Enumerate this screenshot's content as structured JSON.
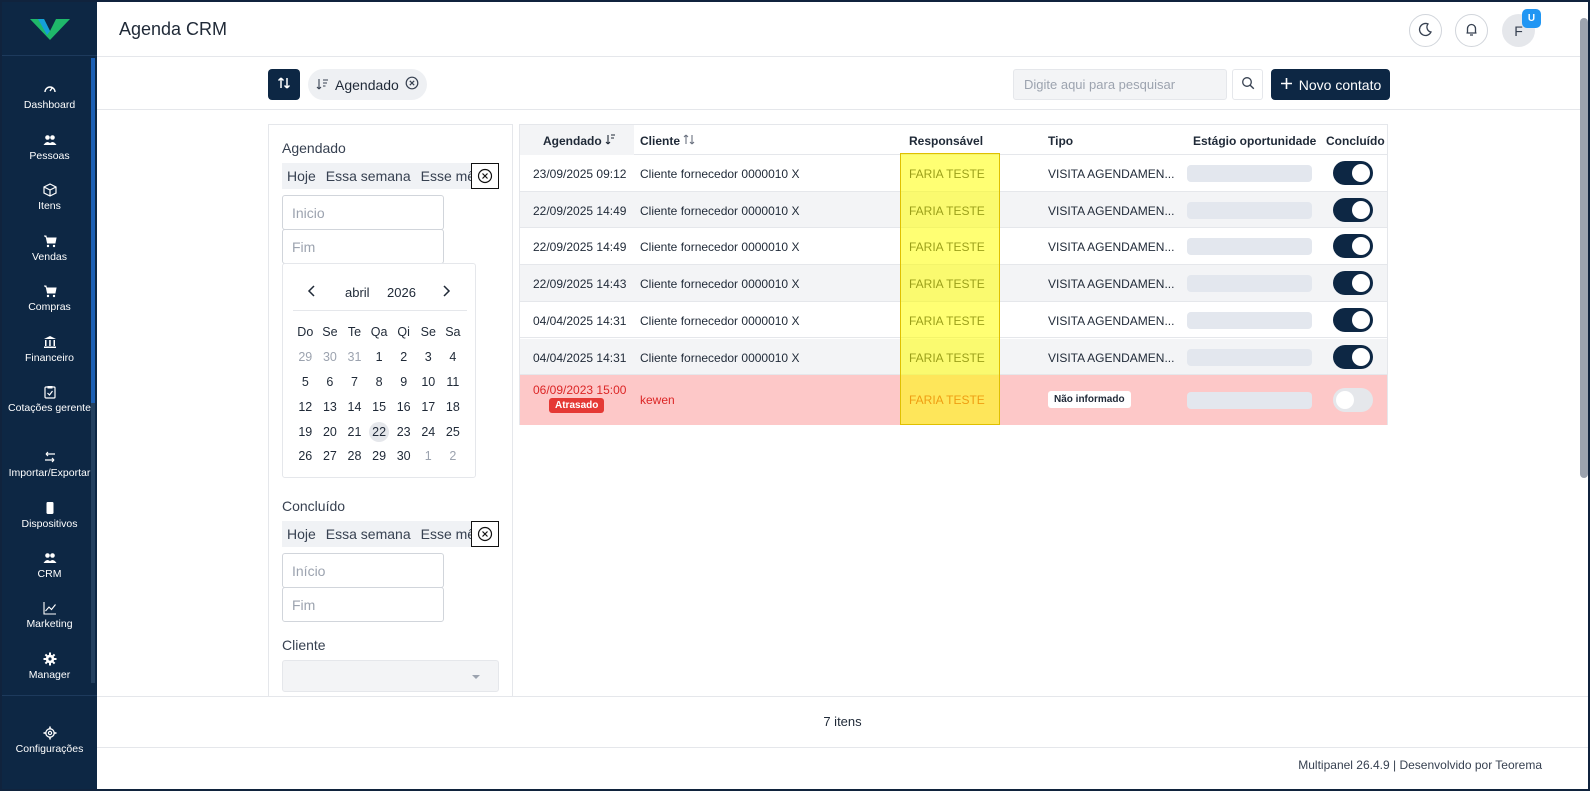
{
  "header": {
    "title": "Agenda CRM",
    "avatar_initial": "F",
    "avatar_badge": "U"
  },
  "sidebar": {
    "items": [
      {
        "label": "Dashboard",
        "icon": "gauge-icon"
      },
      {
        "label": "Pessoas",
        "icon": "people-icon"
      },
      {
        "label": "Itens",
        "icon": "box-icon"
      },
      {
        "label": "Vendas",
        "icon": "cart-icon"
      },
      {
        "label": "Compras",
        "icon": "cart-icon"
      },
      {
        "label": "Financeiro",
        "icon": "bank-icon"
      },
      {
        "label": "Cotações gerente",
        "icon": "clipboard-icon"
      },
      {
        "label": "Importar/Exportar",
        "icon": "arrows-icon"
      },
      {
        "label": "Dispositivos",
        "icon": "phone-icon"
      },
      {
        "label": "CRM",
        "icon": "people-icon"
      },
      {
        "label": "Marketing",
        "icon": "chart-icon"
      },
      {
        "label": "Manager",
        "icon": "gear-icon"
      }
    ],
    "settings_label": "Configurações"
  },
  "toolbar": {
    "chip_label": "Agendado",
    "search_placeholder": "Digite aqui para pesquisar",
    "new_contact_label": "Novo contato"
  },
  "filters": {
    "agendado": {
      "label": "Agendado",
      "quick": [
        "Hoje",
        "Essa semana",
        "Esse mês"
      ],
      "start_placeholder": "Inicio",
      "end_placeholder": "Fim"
    },
    "calendar": {
      "month": "abril",
      "year": "2026",
      "weekdays": [
        "Do",
        "Se",
        "Te",
        "Qa",
        "Qi",
        "Se",
        "Sa"
      ],
      "today": "22"
    },
    "concluido": {
      "label": "Concluído",
      "quick": [
        "Hoje",
        "Essa semana",
        "Esse mês"
      ],
      "start_placeholder": "Início",
      "end_placeholder": "Fim"
    },
    "cliente": {
      "label": "Cliente",
      "value": ""
    }
  },
  "table": {
    "columns": {
      "agendado": "Agendado",
      "cliente": "Cliente",
      "responsavel": "Responsável",
      "tipo": "Tipo",
      "estagio": "Estágio oportunidade",
      "concluido": "Concluído"
    },
    "rows": [
      {
        "agendado": "23/09/2025 09:12",
        "cliente": "Cliente fornecedor 0000010 X",
        "responsavel": "FARIA TESTE",
        "tipo": "VISITA AGENDAMEN...",
        "concluido": true
      },
      {
        "agendado": "22/09/2025 14:49",
        "cliente": "Cliente fornecedor 0000010 X",
        "responsavel": "FARIA TESTE",
        "tipo": "VISITA AGENDAMEN...",
        "concluido": true
      },
      {
        "agendado": "22/09/2025 14:49",
        "cliente": "Cliente fornecedor 0000010 X",
        "responsavel": "FARIA TESTE",
        "tipo": "VISITA AGENDAMEN...",
        "concluido": true
      },
      {
        "agendado": "22/09/2025 14:43",
        "cliente": "Cliente fornecedor 0000010 X",
        "responsavel": "FARIA TESTE",
        "tipo": "VISITA AGENDAMEN...",
        "concluido": true
      },
      {
        "agendado": "04/04/2025 14:31",
        "cliente": "Cliente fornecedor 0000010 X",
        "responsavel": "FARIA TESTE",
        "tipo": "VISITA AGENDAMEN...",
        "concluido": true
      },
      {
        "agendado": "04/04/2025 14:31",
        "cliente": "Cliente fornecedor 0000010 X",
        "responsavel": "FARIA TESTE",
        "tipo": "VISITA AGENDAMEN...",
        "concluido": true
      }
    ],
    "late_row": {
      "agendado": "06/09/2023 15:00",
      "badge": "Atrasado",
      "cliente": "kewen",
      "responsavel": "FARIA TESTE",
      "tipo": "Não informado",
      "concluido": false
    }
  },
  "footer": {
    "count": "7 itens",
    "version": "Multipanel  26.4.9",
    "credit": "Desenvolvido por Teorema"
  },
  "colors": {
    "brand": "#0d2744",
    "accent": "#2196f3",
    "late": "#e53935",
    "highlight": "#ffff00"
  }
}
